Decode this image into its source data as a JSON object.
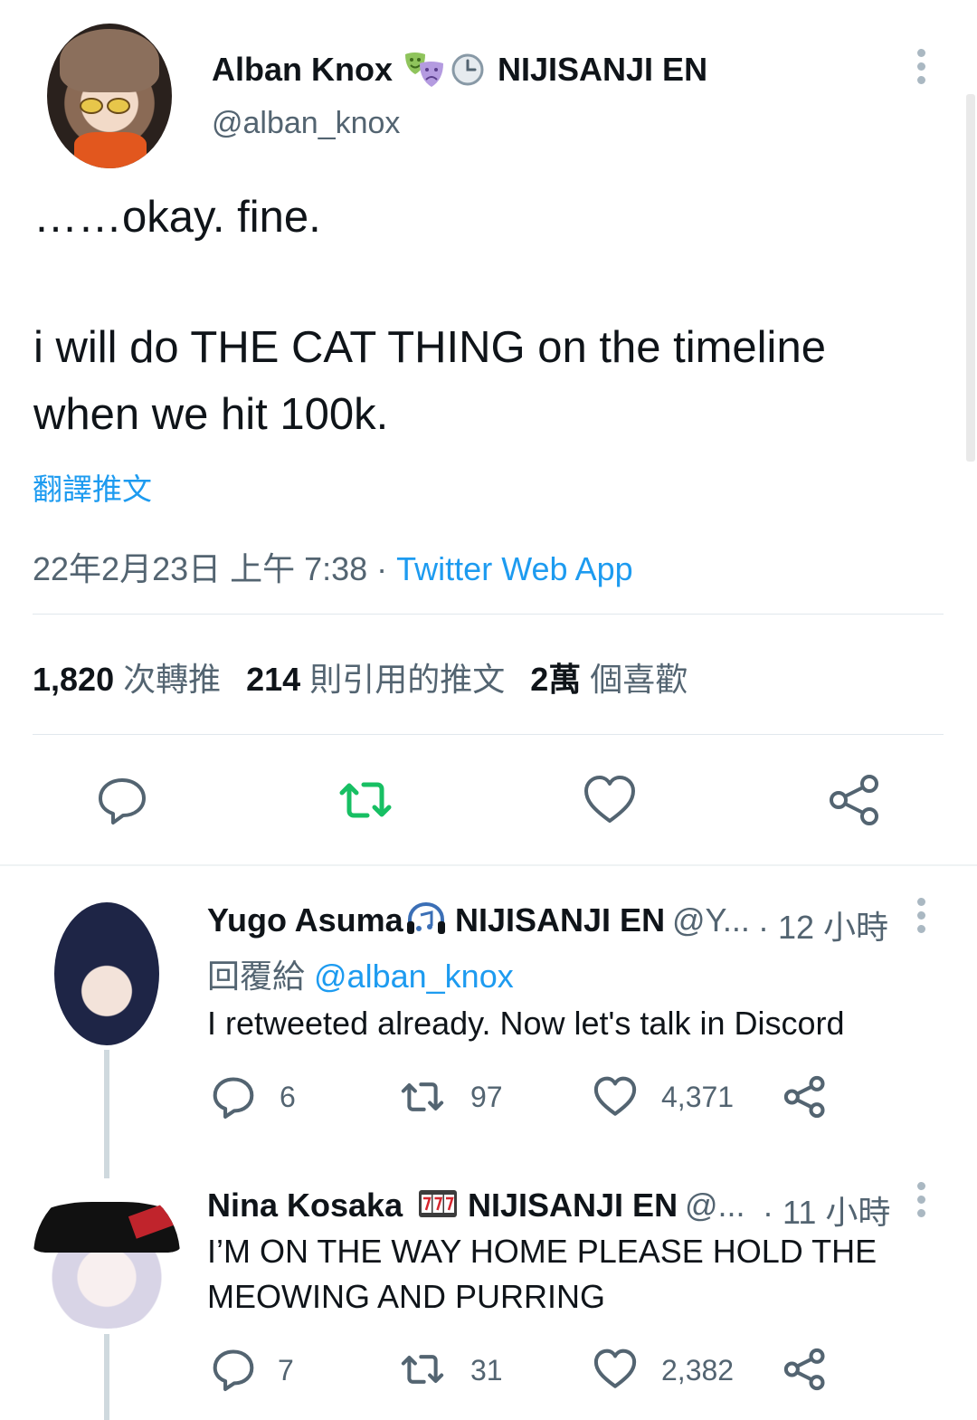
{
  "tweet": {
    "author": {
      "name": "Alban Knox",
      "badge_icons": [
        "theater-masks-icon",
        "clock-icon"
      ],
      "affiliation": "NIJISANJI EN",
      "handle": "@alban_knox"
    },
    "text_lines": [
      "……okay. fine.",
      "i will do THE CAT THING on the timeline",
      "when we hit 100k."
    ],
    "translate_label": "翻譯推文",
    "timestamp": "22年2月23日 上午 7:38 · ",
    "source": "Twitter Web App",
    "stats": {
      "retweets_count": "1,820",
      "retweets_label": "次轉推",
      "quotes_count": "214",
      "quotes_label": "則引用的推文",
      "likes_count": "2萬",
      "likes_label": "個喜歡"
    },
    "actions": [
      "reply-icon",
      "retweet-icon",
      "like-icon",
      "share-icon"
    ],
    "colors": {
      "retweet_active": "#17bf63",
      "link": "#1d9bf0",
      "secondary_text": "#536471"
    }
  },
  "replies": [
    {
      "name": "Yugo Asuma",
      "badge_icon": "headphones-music-icon",
      "affiliation": "NIJISANJI EN",
      "handle": "@Y...",
      "time": "· 12 小時",
      "reply_to_label": "回覆給 ",
      "reply_to_handle": "@alban_knox",
      "text_lines": [
        "I retweeted already. Now let's talk in Discord"
      ],
      "replies": "6",
      "retweets": "97",
      "likes": "4,371"
    },
    {
      "name": "Nina Kosaka",
      "badge_icon": "slot-machine-777-icon",
      "affiliation": "NIJISANJI EN",
      "handle": "@...",
      "time": "· 11 小時",
      "text_lines": [
        "I’M ON THE WAY HOME PLEASE HOLD THE",
        "MEOWING AND PURRING"
      ],
      "replies": "7",
      "retweets": "31",
      "likes": "2,382"
    }
  ]
}
